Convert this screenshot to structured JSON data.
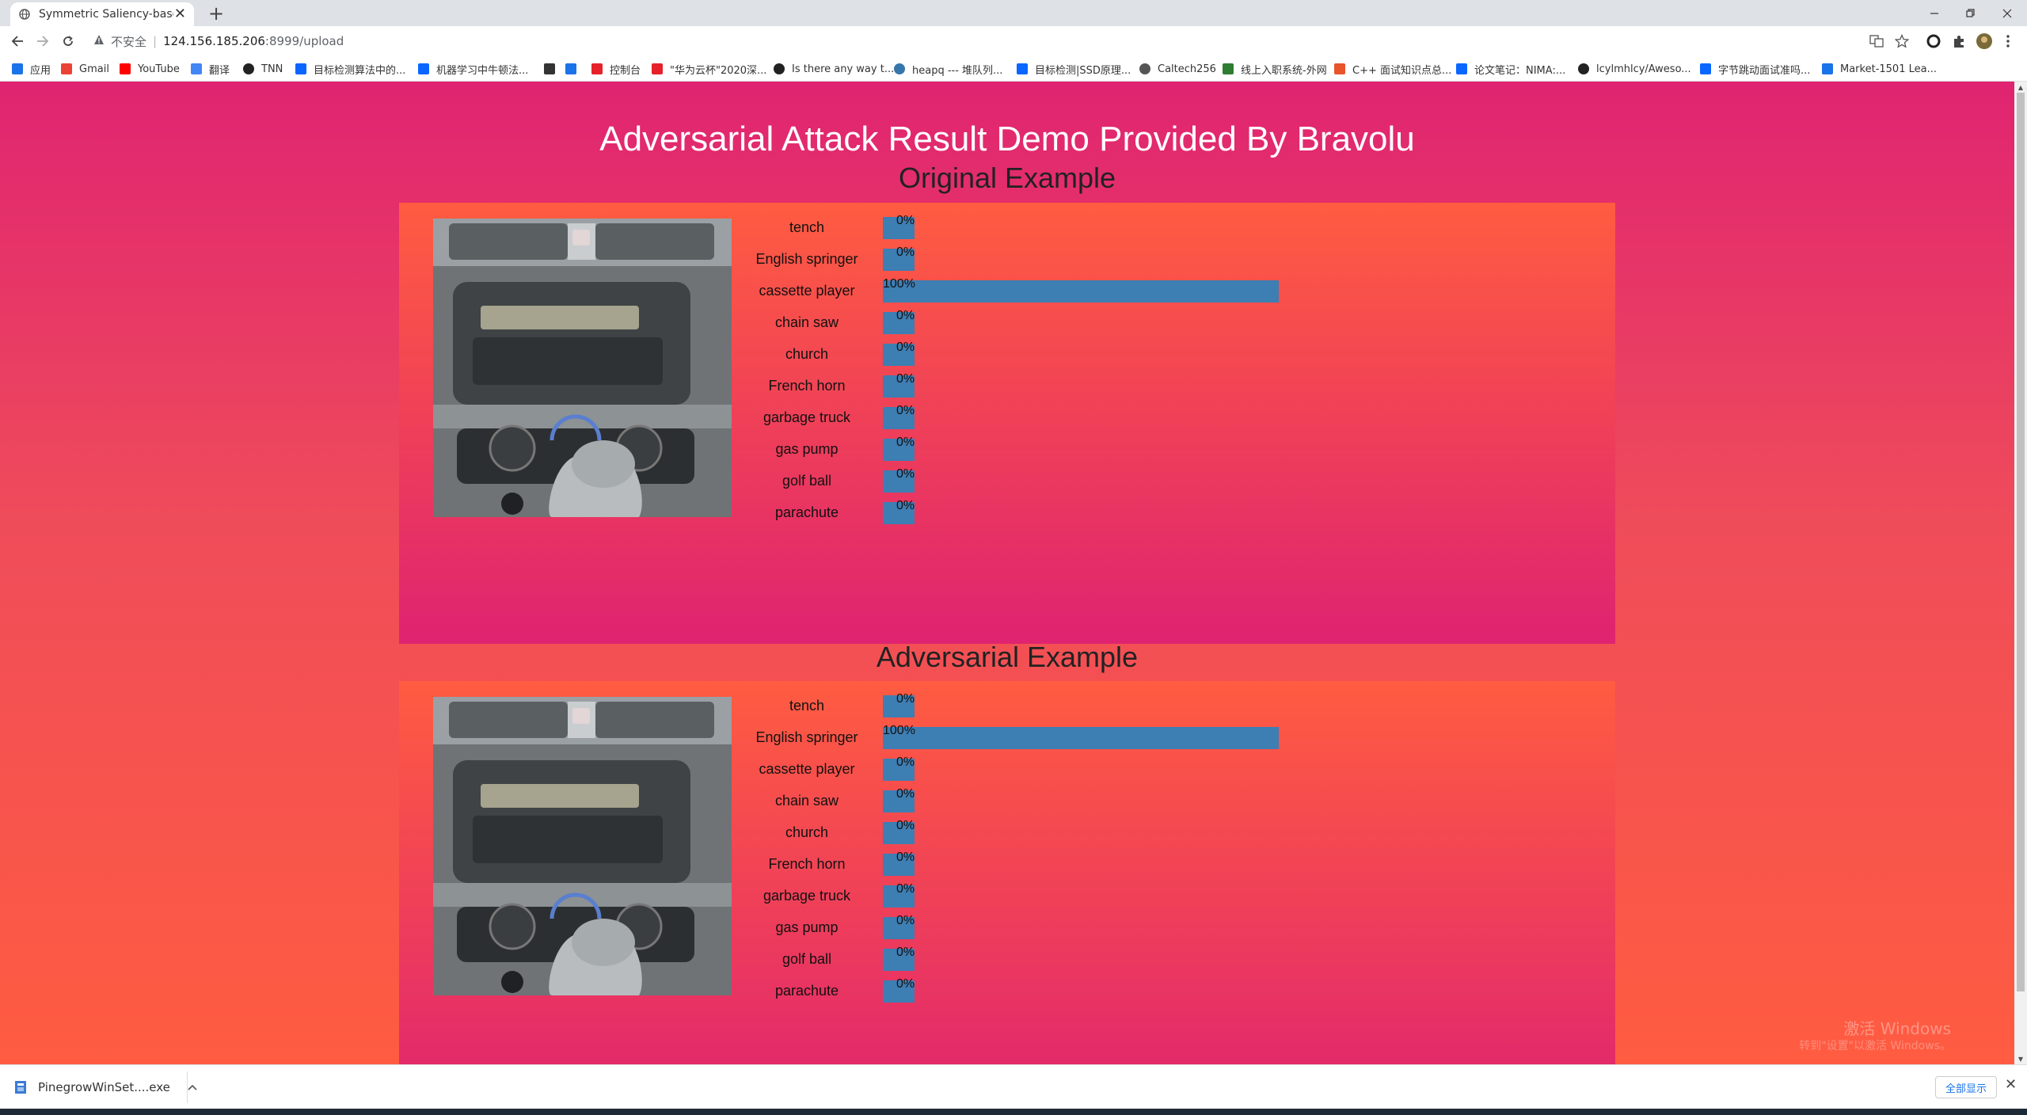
{
  "browser": {
    "tab_title": "Symmetric Saliency-based Au",
    "new_tab": "+",
    "tab_close": "✕",
    "url_warning": "不安全",
    "url_separator": "|",
    "url_host": "124.156.185.206",
    "url_path": ":8999/upload"
  },
  "bookmarks": [
    {
      "label": "应用",
      "icon": "apps-grid-icon",
      "color": "#1a73e8"
    },
    {
      "label": "Gmail",
      "icon": "gmail-icon",
      "color": "#ea4335"
    },
    {
      "label": "YouTube",
      "icon": "youtube-icon",
      "color": "#ff0000"
    },
    {
      "label": "翻译",
      "icon": "translate-icon",
      "color": "#4285f4"
    },
    {
      "label": "TNN",
      "icon": "github-icon",
      "color": "#222222"
    },
    {
      "label": "目标检测算法中的...",
      "icon": "zhihu-icon",
      "color": "#0a66ff"
    },
    {
      "label": "机器学习中牛顿法...",
      "icon": "zhihu-icon",
      "color": "#0a66ff"
    },
    {
      "label": "",
      "icon": "book-icon",
      "color": "#333333"
    },
    {
      "label": "",
      "icon": "folder-icon",
      "color": "#1a73e8"
    },
    {
      "label": "控制台",
      "icon": "huawei-icon",
      "color": "#e6212a"
    },
    {
      "label": "\"华为云杯\"2020深...",
      "icon": "huawei-icon",
      "color": "#e6212a"
    },
    {
      "label": "Is there any way t...",
      "icon": "github-icon",
      "color": "#222222"
    },
    {
      "label": "heapq --- 堆队列...",
      "icon": "python-icon",
      "color": "#3776ab"
    },
    {
      "label": "目标检测|SSD原理...",
      "icon": "zhihu-icon",
      "color": "#0a66ff"
    },
    {
      "label": "Caltech256",
      "icon": "globe-icon",
      "color": "#555555"
    },
    {
      "label": "线上入职系统-外网",
      "icon": "flag-icon",
      "color": "#2e7d32"
    },
    {
      "label": "C++ 面试知识点总...",
      "icon": "csdn-icon",
      "color": "#e8542b"
    },
    {
      "label": "论文笔记：NIMA:...",
      "icon": "zhihu-icon",
      "color": "#0a66ff"
    },
    {
      "label": "lcylmhlcy/Aweso...",
      "icon": "github-icon",
      "color": "#222222"
    },
    {
      "label": "字节跳动面试准吗...",
      "icon": "zhihu-icon",
      "color": "#0a66ff"
    },
    {
      "label": "Market-1501 Lea...",
      "icon": "bookmark-icon",
      "color": "#1a73e8"
    }
  ],
  "page": {
    "title": "Adversarial Attack Result Demo Provided By Bravolu",
    "bar_color": "#3d7eb3"
  },
  "sections": [
    {
      "title": "Original Example",
      "predictions": [
        {
          "label": "tench",
          "value": 0,
          "text": "0%"
        },
        {
          "label": "English springer",
          "value": 0,
          "text": "0%"
        },
        {
          "label": "cassette player",
          "value": 100,
          "text": "100%"
        },
        {
          "label": "chain saw",
          "value": 0,
          "text": "0%"
        },
        {
          "label": "church",
          "value": 0,
          "text": "0%"
        },
        {
          "label": "French horn",
          "value": 0,
          "text": "0%"
        },
        {
          "label": "garbage truck",
          "value": 0,
          "text": "0%"
        },
        {
          "label": "gas pump",
          "value": 0,
          "text": "0%"
        },
        {
          "label": "golf ball",
          "value": 0,
          "text": "0%"
        },
        {
          "label": "parachute",
          "value": 0,
          "text": "0%"
        }
      ]
    },
    {
      "title": "Adversarial Example",
      "predictions": [
        {
          "label": "tench",
          "value": 0,
          "text": "0%"
        },
        {
          "label": "English springer",
          "value": 100,
          "text": "100%"
        },
        {
          "label": "cassette player",
          "value": 0,
          "text": "0%"
        },
        {
          "label": "chain saw",
          "value": 0,
          "text": "0%"
        },
        {
          "label": "church",
          "value": 0,
          "text": "0%"
        },
        {
          "label": "French horn",
          "value": 0,
          "text": "0%"
        },
        {
          "label": "garbage truck",
          "value": 0,
          "text": "0%"
        },
        {
          "label": "gas pump",
          "value": 0,
          "text": "0%"
        },
        {
          "label": "golf ball",
          "value": 0,
          "text": "0%"
        },
        {
          "label": "parachute",
          "value": 0,
          "text": "0%"
        }
      ]
    }
  ],
  "watermark": {
    "line1": "激活 Windows",
    "line2": "转到\"设置\"以激活 Windows。"
  },
  "downloads": {
    "file": "PinegrowWinSet....exe",
    "show_all": "全部显示",
    "close": "✕"
  }
}
